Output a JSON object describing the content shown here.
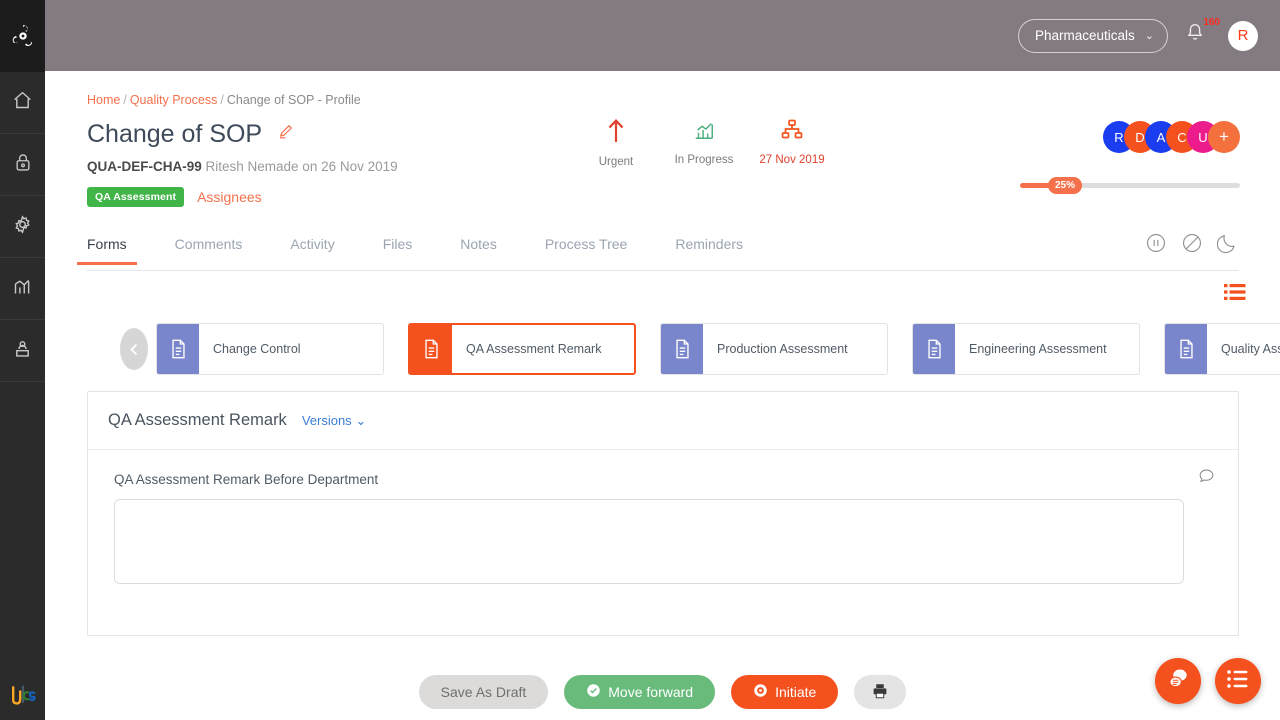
{
  "sidebar": {
    "logo_icon": "propeller-gear-logo",
    "items": [
      {
        "icon": "home-icon",
        "name": "home"
      },
      {
        "icon": "lock-icon",
        "name": "security"
      },
      {
        "icon": "gear-icon",
        "name": "settings"
      },
      {
        "icon": "chart-icon",
        "name": "reports"
      },
      {
        "icon": "podium-user-icon",
        "name": "users"
      }
    ],
    "bottom_logo": "dcs"
  },
  "topbar": {
    "org": "Pharmaceuticals",
    "org_chevron": "⌄",
    "notification_count": "160",
    "bell_icon": "bell-icon",
    "avatar_initial": "R"
  },
  "breadcrumb": {
    "home": "Home",
    "section": "Quality Process",
    "current": "Change of SOP - Profile",
    "separator": "/"
  },
  "header": {
    "title": "Change of SOP",
    "edit_icon": "pencil-icon",
    "code": "QUA-DEF-CHA-99",
    "meta": "Ritesh Nemade on 26 Nov 2019",
    "status_badge": "QA Assessment",
    "assignees_link": "Assignees",
    "badge_color": "#42b549",
    "accent_color": "#f4714c"
  },
  "status_icons": [
    {
      "icon": "up-arrow-icon",
      "label": "Urgent",
      "color": "#e0412c"
    },
    {
      "icon": "bar-chart-icon",
      "label": "In Progress",
      "color": "#4caf7d"
    },
    {
      "icon": "org-chart-icon",
      "label": "27 Nov 2019",
      "color": "#f4511e"
    }
  ],
  "avatars": [
    {
      "initial": "R",
      "color": "#1a3df0"
    },
    {
      "initial": "D",
      "color": "#f4511e"
    },
    {
      "initial": "A",
      "color": "#1a3df0"
    },
    {
      "initial": "C",
      "color": "#f4511e"
    },
    {
      "initial": "U",
      "color": "#ec1c8c"
    },
    {
      "initial": "+",
      "color": "#f4713e"
    }
  ],
  "progress": {
    "percent": "25%",
    "value": 25
  },
  "tabs": [
    {
      "label": "Forms",
      "active": true
    },
    {
      "label": "Comments",
      "active": false
    },
    {
      "label": "Activity",
      "active": false
    },
    {
      "label": "Files",
      "active": false
    },
    {
      "label": "Notes",
      "active": false
    },
    {
      "label": "Process Tree",
      "active": false
    },
    {
      "label": "Reminders",
      "active": false
    }
  ],
  "tab_icons": [
    {
      "icon": "pause-circle-icon"
    },
    {
      "icon": "ban-circle-icon"
    },
    {
      "icon": "moon-refresh-icon"
    }
  ],
  "list_toggle_icon": "list-view-icon",
  "carousel": {
    "prev_icon": "chevron-left-icon",
    "next_icon": "chevron-right-icon",
    "cards": [
      {
        "label": "Change Control",
        "active": false
      },
      {
        "label": "QA Assessment Remark",
        "active": true
      },
      {
        "label": "Production Assessment",
        "active": false
      },
      {
        "label": "Engineering Assessment",
        "active": false
      },
      {
        "label": "Quality Assessment..",
        "active": false
      }
    ]
  },
  "panel": {
    "title": "QA Assessment Remark",
    "versions_label": "Versions",
    "versions_chevron": "⌄",
    "field_label": "QA Assessment Remark Before Department",
    "field_value": "",
    "field_placeholder": "",
    "comment_icon": "comment-bubble-icon"
  },
  "actions": {
    "save_draft": "Save As Draft",
    "move_forward": "Move forward",
    "initiate": "Initiate",
    "print_icon": "printer-icon",
    "forward_icon": "check-circle-icon",
    "initiate_icon": "target-circle-icon"
  },
  "fabs": [
    {
      "icon": "chat-bubbles-icon"
    },
    {
      "icon": "list-lines-icon"
    }
  ]
}
